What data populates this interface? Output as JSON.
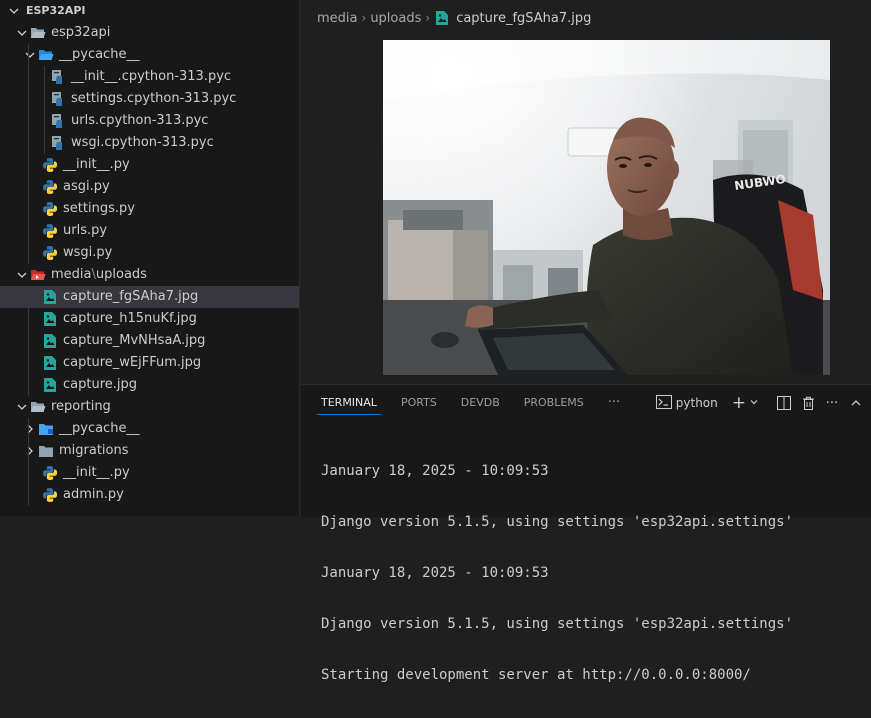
{
  "explorer": {
    "root": "ESP32API",
    "items": [
      {
        "label": "esp32api",
        "icon": "folder-open-icon"
      },
      {
        "label": "__pycache__",
        "icon": "folder-cache-open-icon"
      },
      {
        "label": "__init__.cpython-313.pyc",
        "icon": "python-compiled-file-icon"
      },
      {
        "label": "settings.cpython-313.pyc",
        "icon": "python-compiled-file-icon"
      },
      {
        "label": "urls.cpython-313.pyc",
        "icon": "python-compiled-file-icon"
      },
      {
        "label": "wsgi.cpython-313.pyc",
        "icon": "python-compiled-file-icon"
      },
      {
        "label": "__init__.py",
        "icon": "python-file-icon"
      },
      {
        "label": "asgi.py",
        "icon": "python-file-icon"
      },
      {
        "label": "settings.py",
        "icon": "python-file-icon"
      },
      {
        "label": "urls.py",
        "icon": "python-file-icon"
      },
      {
        "label": "wsgi.py",
        "icon": "python-file-icon"
      },
      {
        "label_a": "media",
        "label_sep": "\\",
        "label_b": "uploads",
        "icon": "folder-media-open-icon"
      },
      {
        "label": "capture_fgSAha7.jpg",
        "icon": "image-file-icon"
      },
      {
        "label": "capture_h15nuKf.jpg",
        "icon": "image-file-icon"
      },
      {
        "label": "capture_MvNHsaA.jpg",
        "icon": "image-file-icon"
      },
      {
        "label": "capture_wEjFFum.jpg",
        "icon": "image-file-icon"
      },
      {
        "label": "capture.jpg",
        "icon": "image-file-icon"
      },
      {
        "label": "reporting",
        "icon": "folder-open-icon"
      },
      {
        "label": "__pycache__",
        "icon": "folder-cache-icon"
      },
      {
        "label": "migrations",
        "icon": "folder-icon"
      },
      {
        "label": "__init__.py",
        "icon": "python-file-icon"
      },
      {
        "label": "admin.py",
        "icon": "python-file-icon"
      }
    ]
  },
  "breadcrumb": {
    "parts": [
      "media",
      "uploads"
    ],
    "file": "capture_fgSAha7.jpg"
  },
  "image_viewer": {
    "overlay_text": "NUBWO"
  },
  "panel": {
    "tabs": [
      "TERMINAL",
      "PORTS",
      "DEVDB",
      "PROBLEMS"
    ],
    "more": "···",
    "shell_name": "python",
    "add": "+"
  },
  "terminal": {
    "lines": [
      "January 18, 2025 - 10:09:53",
      "Django version 5.1.5, using settings 'esp32api.settings'",
      "January 18, 2025 - 10:09:53",
      "Django version 5.1.5, using settings 'esp32api.settings'",
      "Starting development server at http://0.0.0.0:8000/"
    ]
  },
  "colors": {
    "python_blue": "#3572a5",
    "python_yellow": "#ffd43b",
    "image_teal": "#26a69a",
    "folder_blue": "#42a5f5",
    "folder_media_red": "#ef5350",
    "selection": "#37373d",
    "accent": "#0078d4"
  }
}
